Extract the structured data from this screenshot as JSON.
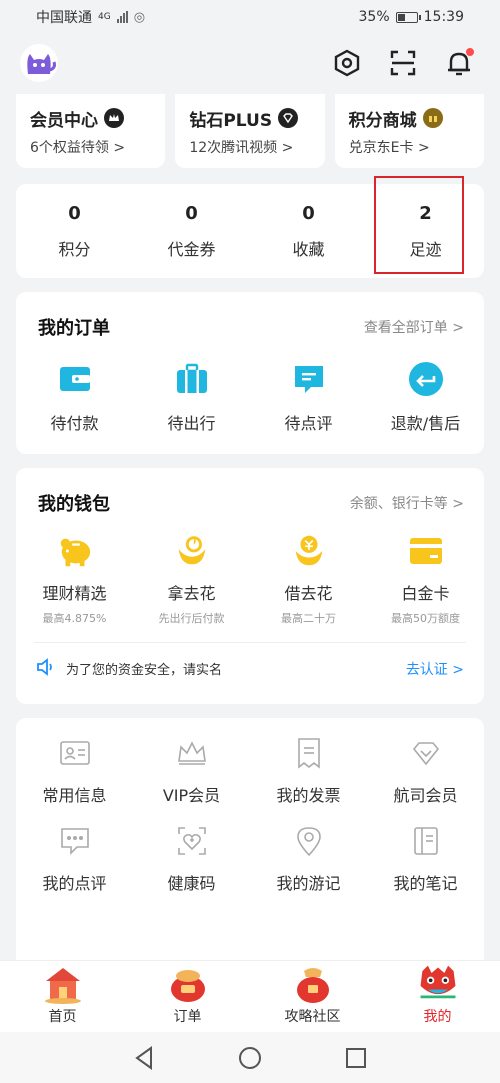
{
  "status": {
    "carrier": "中国联通",
    "network": "4G",
    "battery": "35%",
    "time": "15:39"
  },
  "header": {
    "avatar_icon": "cat-avatar-icon",
    "icons": [
      "settings-icon",
      "scan-icon",
      "bell-icon"
    ]
  },
  "members": [
    {
      "title": "会员中心",
      "sub": "6个权益待领 >",
      "icon": "crown-icon",
      "color": "#222222"
    },
    {
      "title": "钻石PLUS",
      "sub": "12次腾讯视频 >",
      "icon": "diamond-icon",
      "color": "#222222"
    },
    {
      "title": "积分商城",
      "sub": "兑京东E卡 >",
      "icon": "gift-icon",
      "color": "#8a6b18"
    }
  ],
  "stats": [
    {
      "num": "0",
      "label": "积分"
    },
    {
      "num": "0",
      "label": "代金券"
    },
    {
      "num": "0",
      "label": "收藏"
    },
    {
      "num": "2",
      "label": "足迹"
    }
  ],
  "orders": {
    "title": "我的订单",
    "more": "查看全部订单 >",
    "items": [
      {
        "label": "待付款",
        "icon": "wallet-icon"
      },
      {
        "label": "待出行",
        "icon": "suitcase-icon"
      },
      {
        "label": "待点评",
        "icon": "comment-icon"
      },
      {
        "label": "退款/售后",
        "icon": "refund-icon"
      }
    ]
  },
  "wallet": {
    "title": "我的钱包",
    "more": "余额、银行卡等 >",
    "items": [
      {
        "label": "理财精选",
        "sub": "最高4.875%",
        "icon": "piggy-bank-icon"
      },
      {
        "label": "拿去花",
        "sub": "先出行后付款",
        "icon": "flower-icon"
      },
      {
        "label": "借去花",
        "sub": "最高二十万",
        "icon": "coin-flower-icon"
      },
      {
        "label": "白金卡",
        "sub": "最高50万额度",
        "icon": "card-icon"
      }
    ],
    "notice": "为了您的资金安全，请实名",
    "notice_action": "去认证 >"
  },
  "tools": [
    [
      {
        "label": "常用信息",
        "icon": "id-card-icon"
      },
      {
        "label": "VIP会员",
        "icon": "vip-crown-icon"
      },
      {
        "label": "我的发票",
        "icon": "invoice-icon"
      },
      {
        "label": "航司会员",
        "icon": "airline-diamond-icon"
      }
    ],
    [
      {
        "label": "我的点评",
        "icon": "review-icon"
      },
      {
        "label": "健康码",
        "icon": "health-code-icon"
      },
      {
        "label": "我的游记",
        "icon": "location-pin-icon"
      },
      {
        "label": "我的笔记",
        "icon": "notebook-icon"
      }
    ]
  ],
  "tabs": [
    {
      "label": "首页",
      "icon": "home-tab-icon",
      "active": false
    },
    {
      "label": "订单",
      "icon": "order-tab-icon",
      "active": false
    },
    {
      "label": "攻略社区",
      "icon": "community-tab-icon",
      "active": false
    },
    {
      "label": "我的",
      "icon": "mine-tab-icon",
      "active": true
    }
  ],
  "colors": {
    "accent": "#1fb6e0",
    "highlight_box": "#d9262c",
    "active_tab": "#e0242a",
    "link": "#1e90ff"
  }
}
